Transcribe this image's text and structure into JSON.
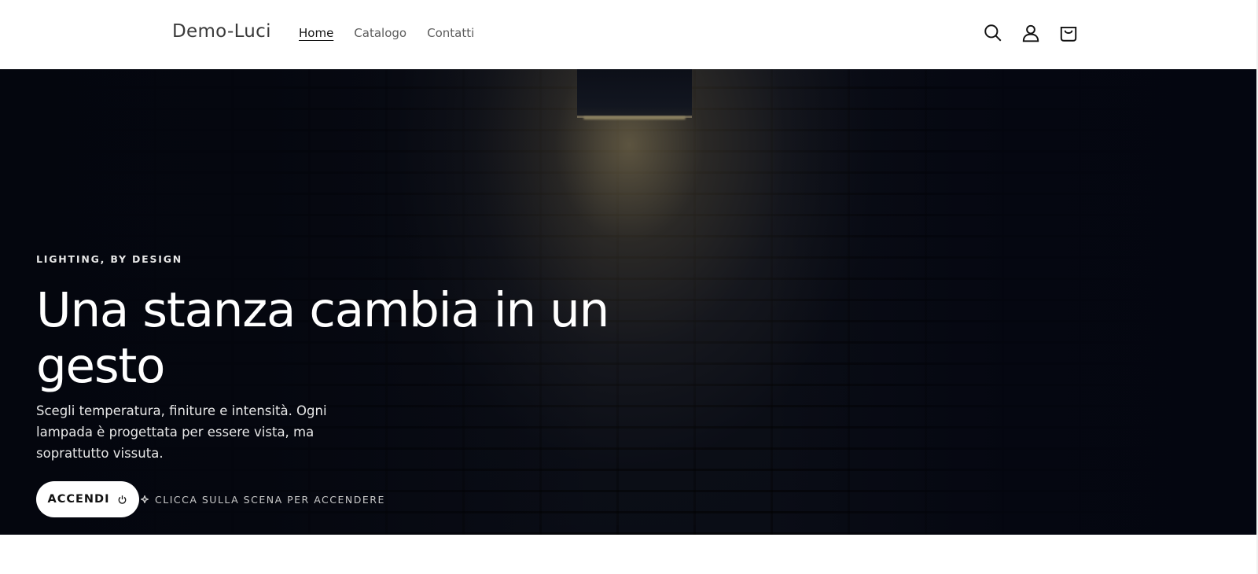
{
  "header": {
    "logo": "Demo-Luci",
    "nav": [
      {
        "label": "Home",
        "active": true
      },
      {
        "label": "Catalogo",
        "active": false
      },
      {
        "label": "Contatti",
        "active": false
      }
    ],
    "icons": [
      "search-icon",
      "account-icon",
      "cart-icon"
    ]
  },
  "hero": {
    "eyebrow": "LIGHTING, BY DESIGN",
    "headline": "Una stanza cambia in un gesto",
    "subtext": "Scegli temperatura, finiture e intensità. Ogni lampada è progettata per essere vista, ma soprattutto vissuta.",
    "cta_label": "ACCENDI",
    "cta_icon": "power-icon",
    "hint_icon": "sparkle-icon",
    "hint": "CLICCA SULLA SCENA PER ACCENDERE"
  },
  "colors": {
    "hero_background": "#060911",
    "button_background": "#ffffff",
    "text_light": "#ffffff",
    "text_dark": "#121212"
  }
}
